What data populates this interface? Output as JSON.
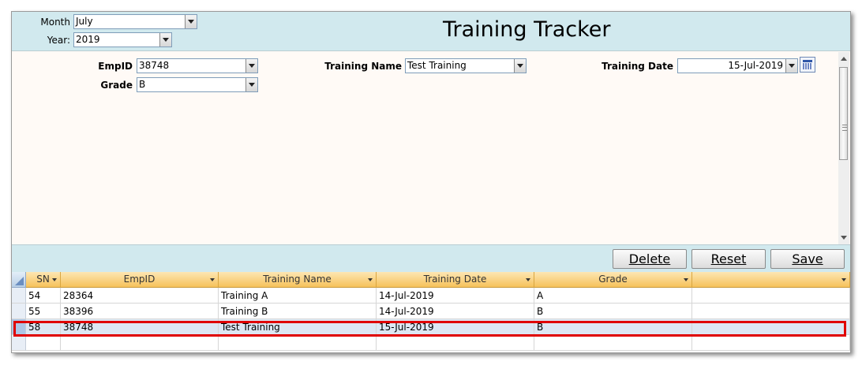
{
  "header": {
    "month_label": "Month",
    "month_value": "July",
    "year_label": "Year:",
    "year_value": "2019",
    "title": "Training Tracker"
  },
  "form": {
    "empid_label": "EmpID",
    "empid_value": "38748",
    "grade_label": "Grade",
    "grade_value": "B",
    "training_name_label": "Training Name",
    "training_name_value": "Test Training",
    "training_date_label": "Training Date",
    "training_date_value": "15-Jul-2019"
  },
  "actions": {
    "delete_label": "Delete",
    "reset_label": "Reset",
    "save_label": "Save"
  },
  "grid": {
    "columns": [
      "SN",
      "EmpID",
      "Training Name",
      "Training Date",
      "Grade",
      ""
    ],
    "rows": [
      {
        "sn": "54",
        "empid": "28364",
        "training_name": "Training A",
        "training_date": "14-Jul-2019",
        "grade": "A"
      },
      {
        "sn": "55",
        "empid": "38396",
        "training_name": "Training B",
        "training_date": "14-Jul-2019",
        "grade": "B"
      },
      {
        "sn": "58",
        "empid": "38748",
        "training_name": "Test Training",
        "training_date": "15-Jul-2019",
        "grade": "B"
      }
    ],
    "selected_row": 2
  },
  "colors": {
    "header_bg": "#d1e9ee",
    "form_bg": "#fffaf6",
    "grid_header": "#f6c25b",
    "highlight": "#e00000"
  }
}
